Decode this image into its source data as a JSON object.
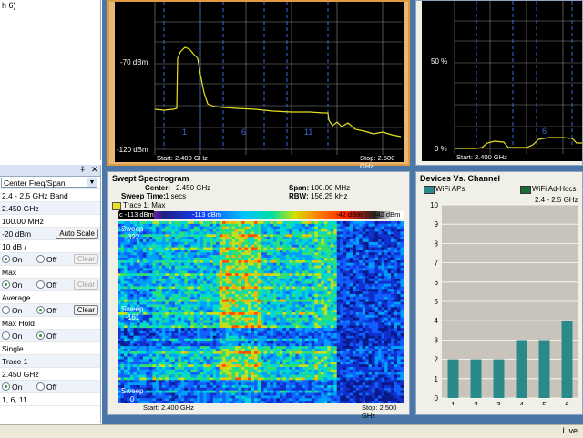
{
  "left_top": {
    "text": "h 6)"
  },
  "settings": {
    "pin_icon": "pin-icon",
    "close_icon": "close-icon",
    "mode_select": "Center Freq/Span",
    "band": "2.4 - 2.5 GHz Band",
    "center": "2.450 GHz",
    "span": "100.00 MHz",
    "ref_level": "-20 dBm",
    "auto_scale": "Auto Scale",
    "scale": "10 dB /",
    "trace1_on": "On",
    "trace1_off": "Off",
    "trace1_clear": "Clear",
    "max_label": "Max",
    "max_on": "On",
    "max_off": "Off",
    "max_clear": "Clear",
    "avg_label": "Average",
    "avg_on": "On",
    "avg_off": "Off",
    "avg_clear": "Clear",
    "maxhold_label": "Max Hold",
    "maxhold_on": "On",
    "maxhold_off": "Off",
    "single": "Single",
    "trace": "Trace 1",
    "marker": "2.450 GHz",
    "marker_on": "On",
    "marker_off": "Off",
    "channels": "1, 6, 11"
  },
  "spectrum": {
    "ylabel_top": "-70 dBm",
    "ylabel_bottom": "-120 dBm",
    "start": "Start: 2.400 GHz",
    "stop": "Stop: 2.500 GHz",
    "channels": [
      "1",
      "6",
      "11"
    ]
  },
  "utilization": {
    "ylabel_top": "50 %",
    "ylabel_bottom": "0 %",
    "start": "Start: 2.400 GHz",
    "channel_marker": "6"
  },
  "spectrogram": {
    "title": "Swept Spectrogram",
    "center_label": "Center:",
    "center": "2.450 GHz",
    "sweep_time_label": "Sweep Time:",
    "sweep_time": "1 secs",
    "span_label": "Span:",
    "span": "100.00 MHz",
    "rbw_label": "RBW:",
    "rbw": "156.25 kHz",
    "legend": "Trace 1: Max",
    "colorbar": [
      "c -113 dBm",
      "-113 dBm",
      "-42 dBm",
      "-42 dBm"
    ],
    "sweep_labels": [
      {
        "line1": "Sweep",
        "line2": "-322"
      },
      {
        "line1": "Sweep",
        "line2": "-161"
      },
      {
        "line1": "Sweep",
        "line2": "0"
      }
    ],
    "start": "Start: 2.400 GHz",
    "stop": "Stop: 2.500 GHz"
  },
  "devices": {
    "title": "Devices Vs. Channel",
    "legend_aps": "WiFi APs",
    "legend_adhoc": "WiFi Ad-Hocs",
    "band": "2.4 - 2.5 GHz",
    "bar_color": "#2a8a8a"
  },
  "chart_data": {
    "type": "bar",
    "title": "Devices Vs. Channel",
    "categories": [
      "1",
      "2",
      "3",
      "4",
      "5",
      "6"
    ],
    "series": [
      {
        "name": "WiFi APs",
        "values": [
          2,
          2,
          2,
          3,
          3,
          4
        ]
      },
      {
        "name": "WiFi Ad-Hocs",
        "values": [
          0,
          0,
          0,
          0,
          0,
          0
        ]
      }
    ],
    "yticks": [
      "0",
      "1",
      "2",
      "3",
      "4",
      "5",
      "6",
      "7",
      "8",
      "9",
      "10"
    ],
    "ylim": [
      0,
      10
    ],
    "legend": "top"
  },
  "status": {
    "text": "Live"
  }
}
